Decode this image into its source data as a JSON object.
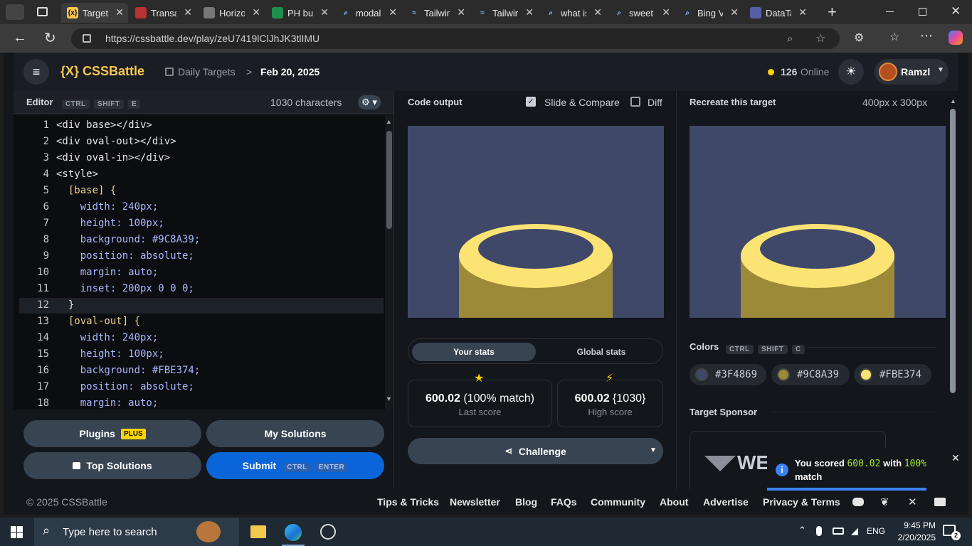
{
  "browser": {
    "tabs": [
      {
        "title": "Target",
        "icon": "cssbattle-icon",
        "active": true
      },
      {
        "title": "Transa",
        "icon": "transaction-icon"
      },
      {
        "title": "Horizo",
        "icon": "horizon-icon"
      },
      {
        "title": "PH bus",
        "icon": "sheets-icon"
      },
      {
        "title": "modal",
        "icon": "search-icon"
      },
      {
        "title": "Tailwin",
        "icon": "tailwind-icon"
      },
      {
        "title": "Tailwin",
        "icon": "tailwind-icon"
      },
      {
        "title": "what is",
        "icon": "search-icon"
      },
      {
        "title": "sweet a",
        "icon": "search-icon"
      },
      {
        "title": "Bing V",
        "icon": "search-icon"
      },
      {
        "title": "DataTa",
        "icon": "datatables-icon"
      }
    ],
    "new_tab": "+",
    "url": "https://cssbattle.dev/play/zeU7419lClJhJK3tlIMU"
  },
  "header": {
    "logo": "{X} CSSBattle",
    "breadcrumb_parent": "Daily Targets",
    "breadcrumb_sep": ">",
    "breadcrumb_current": "Feb 20, 2025",
    "online_count": "126",
    "online_label": "Online",
    "username": "Ramzl"
  },
  "editor": {
    "title": "Editor",
    "keys": [
      "CTRL",
      "SHIFT",
      "E"
    ],
    "char_count": "1030 characters",
    "lines": [
      {
        "n": "1",
        "code": "<div base></div>"
      },
      {
        "n": "2",
        "code": "<div oval-out></div>"
      },
      {
        "n": "3",
        "code": "<div oval-in></div>"
      },
      {
        "n": "4",
        "code": "<style>"
      },
      {
        "n": "5",
        "code": "  [base] {"
      },
      {
        "n": "6",
        "code": "    width: 240px;"
      },
      {
        "n": "7",
        "code": "    height: 100px;"
      },
      {
        "n": "8",
        "code": "    background: #9C8A39;"
      },
      {
        "n": "9",
        "code": "    position: absolute;"
      },
      {
        "n": "10",
        "code": "    margin: auto;"
      },
      {
        "n": "11",
        "code": "    inset: 200px 0 0 0;"
      },
      {
        "n": "12",
        "code": "  }"
      },
      {
        "n": "13",
        "code": "  [oval-out] {"
      },
      {
        "n": "14",
        "code": "    width: 240px;"
      },
      {
        "n": "15",
        "code": "    height: 100px;"
      },
      {
        "n": "16",
        "code": "    background: #FBE374;"
      },
      {
        "n": "17",
        "code": "    position: absolute;"
      },
      {
        "n": "18",
        "code": "    margin: auto;"
      }
    ]
  },
  "buttons": {
    "plugins": "Plugins",
    "plus_badge": "PLUS",
    "my_solutions": "My Solutions",
    "top_solutions": "Top Solutions",
    "submit": "Submit",
    "submit_keys": [
      "CTRL",
      "ENTER"
    ]
  },
  "output": {
    "title": "Code output",
    "slide_compare": "Slide & Compare",
    "diff": "Diff",
    "tab_your": "Your stats",
    "tab_global": "Global stats",
    "last_score_value": "600.02",
    "last_score_match": "(100% match)",
    "last_score_label": "Last score",
    "high_score_value": "600.02",
    "high_score_chars": "{1030}",
    "high_score_label": "High score",
    "challenge": "Challenge"
  },
  "target": {
    "title": "Recreate this target",
    "size": "400px x 300px",
    "colors_label": "Colors",
    "colors_keys": [
      "CTRL",
      "SHIFT",
      "C"
    ],
    "colors": [
      {
        "hex": "#3F4869"
      },
      {
        "hex": "#9C8A39"
      },
      {
        "hex": "#FBE374"
      }
    ],
    "sponsor_label": "Target Sponsor",
    "sponsor_logo_text": "WE"
  },
  "toast": {
    "prefix": "You scored",
    "score": "600.02",
    "middle": "with",
    "match": "100%",
    "suffix": "match"
  },
  "footer": {
    "copyright": "© 2025 CSSBattle",
    "links": [
      "Tips & Tricks",
      "Newsletter",
      "Blog",
      "FAQs",
      "Community",
      "About",
      "Advertise",
      "Privacy & Terms"
    ]
  },
  "taskbar": {
    "search_placeholder": "Type here to search",
    "lang": "ENG",
    "time": "9:45 PM",
    "date": "2/20/2025",
    "notifications": "2"
  },
  "colors": {
    "bg": "#3F4869",
    "base": "#9C8A39",
    "oval": "#FBE374",
    "accent": "#0a66d8",
    "brand": "#f9c74f"
  }
}
